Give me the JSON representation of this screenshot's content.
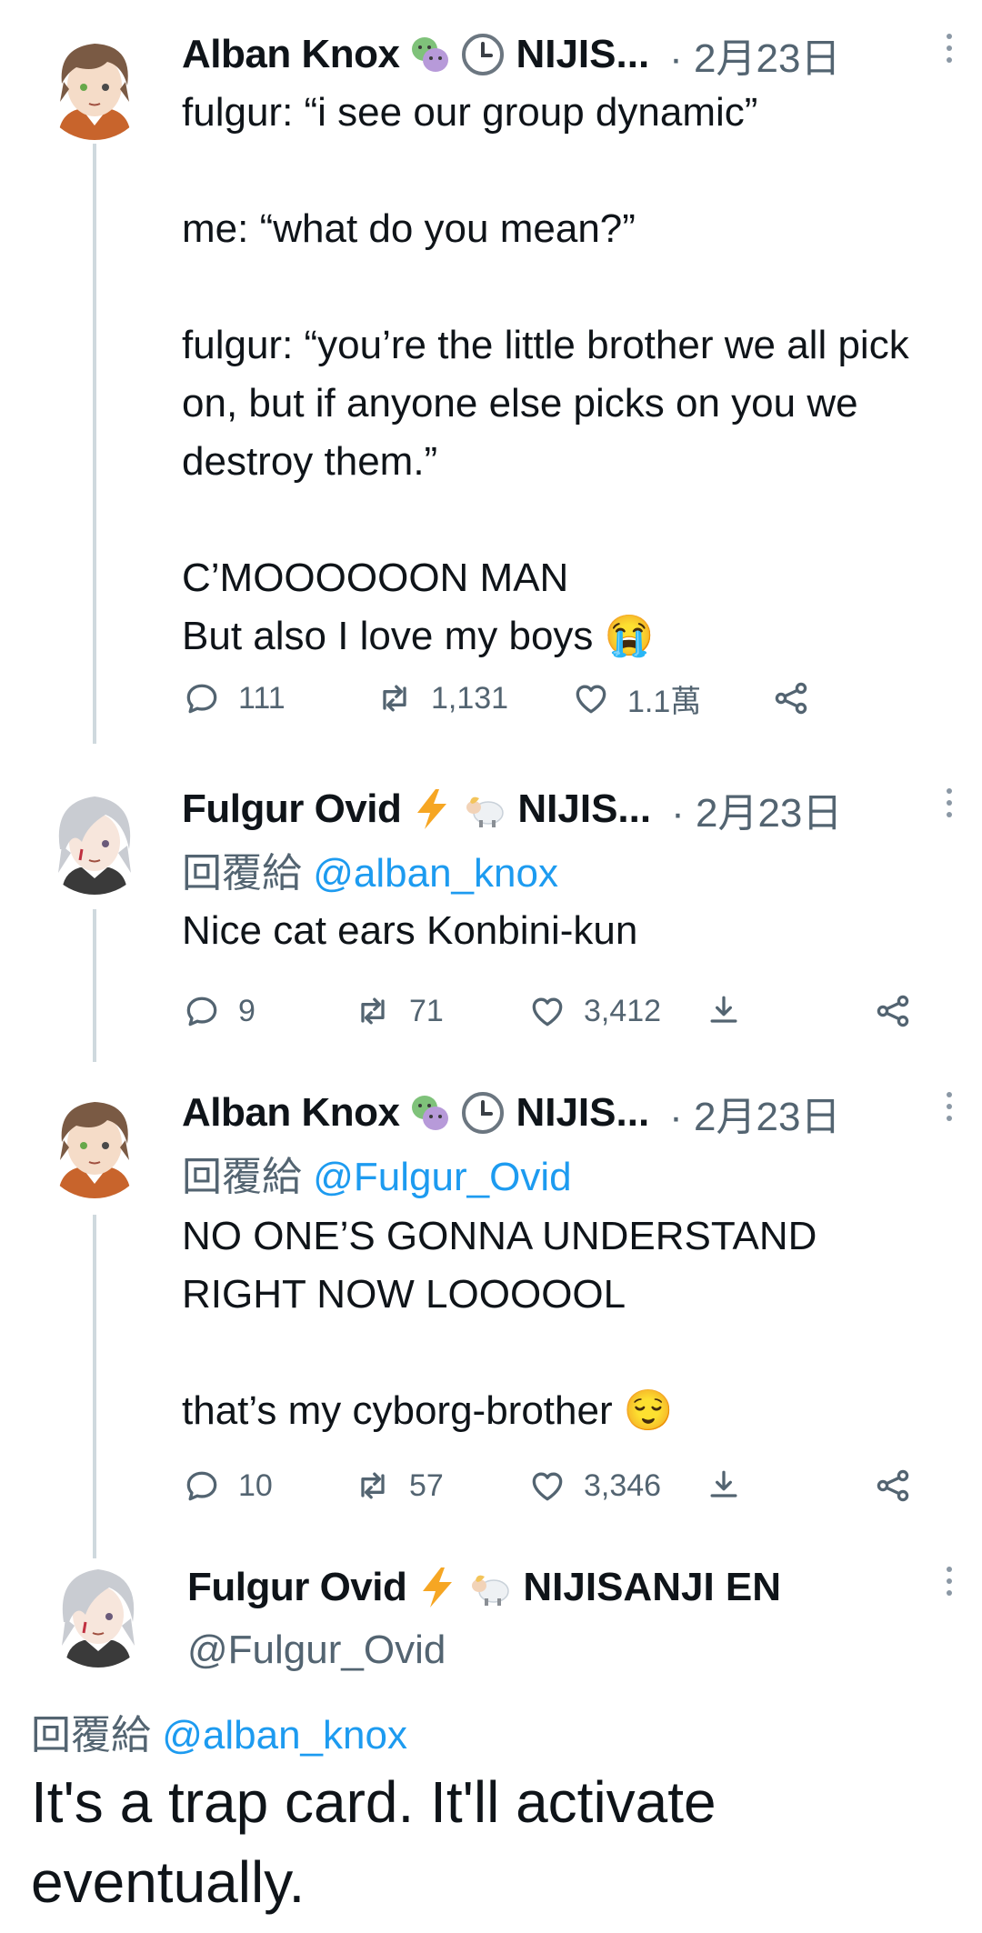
{
  "tweets": [
    {
      "name": "Alban Knox",
      "handle_short": "NIJIS...",
      "date": "· 2月23日",
      "reply_prefix": "",
      "reply_mention": "",
      "body": "fulgur: “i see our group dynamic”\n\nme: “what do you mean?”\n\nfulgur: “you’re the little brother we all pick on, but if anyone else picks on you we destroy them.”\n\nC’MOOOOOON MAN\nBut also I love my boys 😭",
      "replies": "111",
      "retweets": "1,131",
      "likes": "1.1萬"
    },
    {
      "name": "Fulgur Ovid",
      "handle_short": "NIJIS...",
      "date": "· 2月23日",
      "reply_prefix": "回覆給",
      "reply_mention": "@alban_knox",
      "body": "Nice cat ears Konbini-kun",
      "replies": "9",
      "retweets": "71",
      "likes": "3,412"
    },
    {
      "name": "Alban Knox",
      "handle_short": "NIJIS...",
      "date": "· 2月23日",
      "reply_prefix": "回覆給",
      "reply_mention": "@Fulgur_Ovid",
      "body": "NO ONE’S GONNA UNDERSTAND\nRIGHT NOW LOOOOOL\n\nthat’s my cyborg-brother 😌",
      "replies": "10",
      "retweets": "57",
      "likes": "3,346"
    }
  ],
  "final_tweet": {
    "name": "Fulgur Ovid",
    "org": "NIJISANJI EN",
    "handle": "@Fulgur_Ovid",
    "reply_prefix": "回覆給",
    "reply_mention": "@alban_knox",
    "body": "It's a trap card. It'll activate eventually."
  },
  "colors": {
    "text": "#0f1419",
    "secondary": "#536471",
    "link": "#1d9bf0",
    "thread_line": "#cfd9de"
  },
  "icons": [
    "reply-icon",
    "retweet-icon",
    "like-icon",
    "share-icon",
    "download-icon",
    "more-icon"
  ]
}
